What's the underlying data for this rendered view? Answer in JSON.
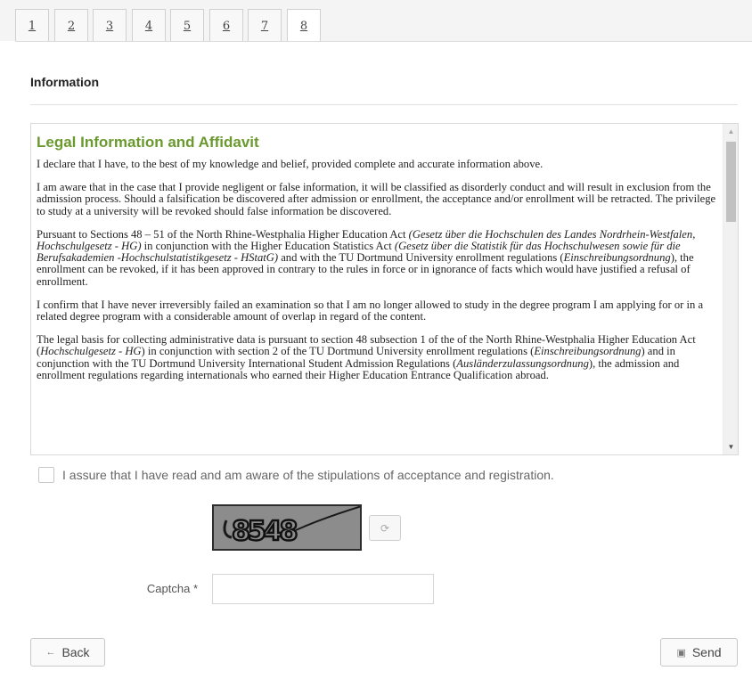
{
  "tabs": [
    {
      "label": "1"
    },
    {
      "label": "2"
    },
    {
      "label": "3"
    },
    {
      "label": "4"
    },
    {
      "label": "5"
    },
    {
      "label": "6"
    },
    {
      "label": "7"
    },
    {
      "label": "8",
      "active": true
    }
  ],
  "section": {
    "title": "Information"
  },
  "legal": {
    "heading": "Legal Information and Affidavit",
    "p1": "I declare that I have, to the best of my knowledge and belief, provided complete and accurate information above.",
    "p2": "I am aware that in the case that I provide negligent or false information, it will be classified as disorderly conduct and will result in exclusion from the admission process. Should a falsification be discovered after admission or enrollment, the acceptance and/or enrollment will be retracted. The privilege to study at a university will be revoked should false information be discovered.",
    "p3": {
      "a": "Pursuant to Sections 48 – 51 of the North Rhine-Westphalia Higher Education Act ",
      "b": "(Gesetz über die Hochschulen des Landes Nordrhein-Westfalen, Hochschulgesetz - HG)",
      "c": " in conjunction with the Higher Education Statistics Act ",
      "d": "(Gesetz über die Statistik für das Hochschulwesen sowie für die Berufsakademien -Hochschulstatistikgesetz - HStatG)",
      "e": " and with the TU Dortmund University enrollment regulations (",
      "f": "Einschreibungsordnung",
      "g": "), the enrollment can be revoked, if it has been approved in contrary to the rules in force or in ignorance of facts which would have justified a refusal of enrollment."
    },
    "p4": "I confirm that I have never irreversibly failed an examination so that I am no longer allowed to study in the degree program I am applying for or in a related degree program with a considerable amount of overlap in regard of the content.",
    "p5": {
      "a": "The legal basis for collecting administrative data is pursuant to section 48 subsection 1 of the of the North Rhine-Westphalia Higher Education Act (",
      "b": "Hochschulgesetz - HG",
      "c": ") in conjunction with section 2 of the TU Dortmund University enrollment regulations (",
      "d": "Einschreibungsordnung",
      "e": ") and in conjunction with the TU Dortmund University International Student Admission Regulations (",
      "f": "Ausländerzulassungsordnung",
      "g": "), the admission and enrollment regulations regarding internationals who earned their Higher Education Entrance Qualification abroad."
    }
  },
  "scroll": {
    "up_icon": "▲",
    "down_icon": "▼"
  },
  "affirm": {
    "label": "I assure that I have read and am aware of the stipulations of acceptance and registration.",
    "checked": false
  },
  "captcha": {
    "image_text": "8548",
    "refresh_icon": "⟳",
    "label": "Captcha *",
    "value": ""
  },
  "buttons": {
    "back": "Back",
    "back_icon": "←",
    "send": "Send",
    "send_icon": "▣"
  }
}
